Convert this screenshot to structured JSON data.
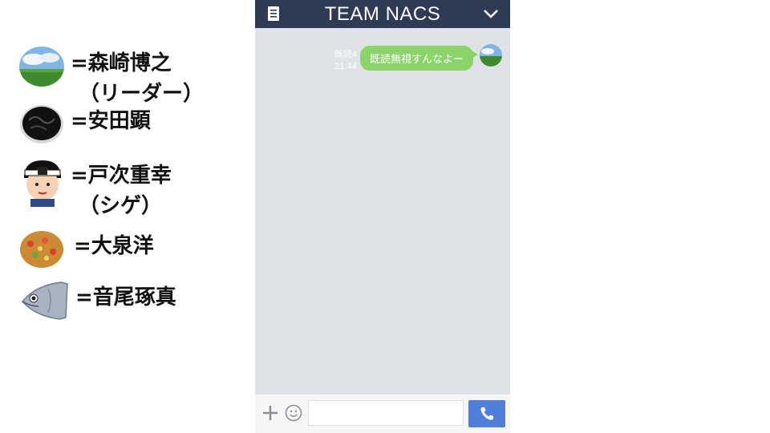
{
  "legend": {
    "items": [
      {
        "icon": "landscape-avatar-icon",
        "name": "=森崎博之",
        "sub": "（リーダー）"
      },
      {
        "icon": "dark-jelly-icon",
        "name": "=安田顕",
        "sub": ""
      },
      {
        "icon": "man-headband-icon",
        "name": "=戸次重幸",
        "sub": "（シゲ）"
      },
      {
        "icon": "paella-icon",
        "name": "=大泉洋",
        "sub": ""
      },
      {
        "icon": "fish-head-icon",
        "name": "=音尾琢真",
        "sub": ""
      }
    ]
  },
  "chat": {
    "title": "TEAM NACS",
    "message": {
      "read_status": "既読4",
      "time": "21:44",
      "text": "既読無視すんなよー"
    },
    "input": {
      "value": ""
    }
  },
  "colors": {
    "header_bg": "#2f3a55",
    "chat_bg": "#dfe2e6",
    "bubble": "#8bd46a",
    "call_button": "#4f7fd8"
  }
}
